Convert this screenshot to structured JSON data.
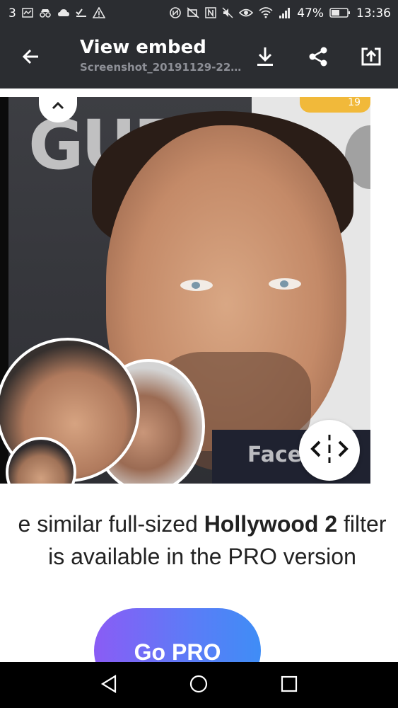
{
  "status_bar": {
    "left_number": "3",
    "left_icons": [
      "activity-icon",
      "incognito-icon",
      "cloud-icon",
      "checklist-icon",
      "warning-icon"
    ],
    "right_icons": [
      "nfc-icon",
      "no-camera-icon",
      "n-icon",
      "mute-icon",
      "eye-icon",
      "wifi-icon",
      "signal-icon"
    ],
    "battery_percent": "47%",
    "time": "13:36"
  },
  "app_bar": {
    "title": "View embed",
    "subtitle": "Screenshot_20191129-22...",
    "icons": [
      "back-arrow-icon",
      "download-icon",
      "share-icon",
      "open-external-icon"
    ]
  },
  "image": {
    "background_text": "GUE",
    "watermark": "Face",
    "badge": "19"
  },
  "caption": {
    "line1_prefix": "e similar full-sized ",
    "line1_bold": "Hollywood 2",
    "line1_suffix": " filter",
    "line2": "is available in the PRO version"
  },
  "cta": {
    "label": "Go PRO"
  },
  "nav_bar": {
    "icons": [
      "nav-back-icon",
      "nav-home-icon",
      "nav-recents-icon"
    ]
  },
  "colors": {
    "app_bar_bg": "#2b2d31",
    "cta_gradient_start": "#8a5cf5",
    "cta_gradient_end": "#3f8df6"
  }
}
